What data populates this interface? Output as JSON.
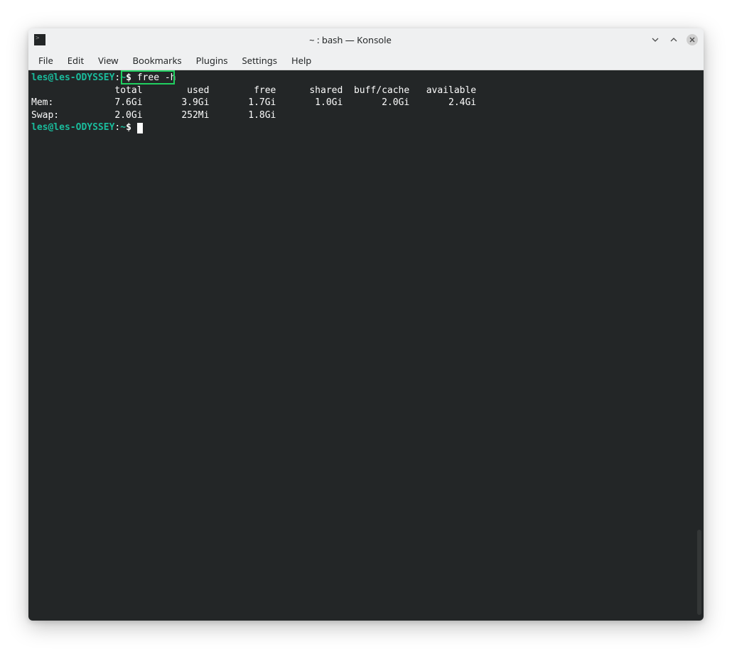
{
  "window": {
    "title": "~ : bash — Konsole"
  },
  "menubar": {
    "items": [
      "File",
      "Edit",
      "View",
      "Bookmarks",
      "Plugins",
      "Settings",
      "Help"
    ]
  },
  "terminal": {
    "prompt": "les@les-ODYSSEY",
    "path": "~",
    "command": "free -h",
    "header": "               total        used        free      shared  buff/cache   available",
    "rows": [
      {
        "label": "Mem:",
        "total": "7.6Gi",
        "used": "3.9Gi",
        "free": "1.7Gi",
        "shared": "1.0Gi",
        "buffcache": "2.0Gi",
        "available": "2.4Gi"
      },
      {
        "label": "Swap:",
        "total": "2.0Gi",
        "used": "252Mi",
        "free": "1.8Gi",
        "shared": "",
        "buffcache": "",
        "available": ""
      }
    ]
  }
}
